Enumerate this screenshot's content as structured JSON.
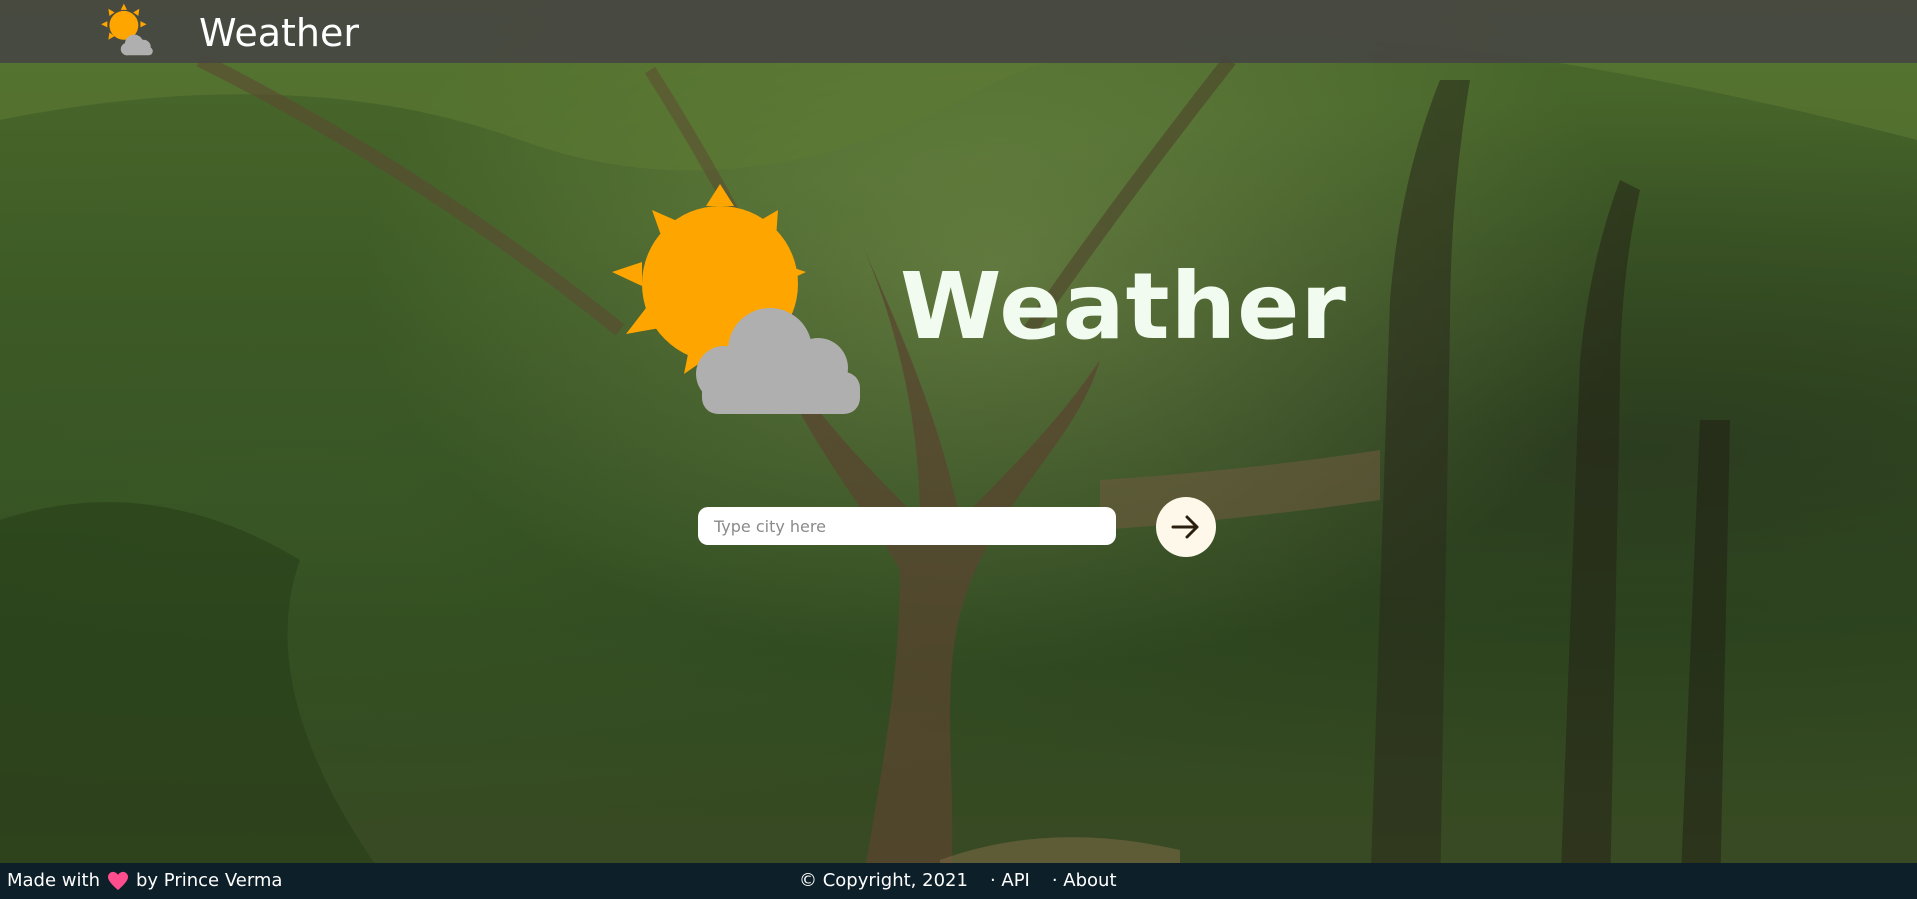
{
  "header": {
    "brand": "Weather",
    "logo_icon": "sun-cloud-icon"
  },
  "hero": {
    "title": "Weather",
    "logo_icon": "sun-cloud-icon"
  },
  "search": {
    "placeholder": "Type city here",
    "value": "",
    "submit_icon": "arrow-right-icon"
  },
  "footer": {
    "made_with": "Made with",
    "by": "by Prince Verma",
    "heart_icon": "heart-icon",
    "copyright": "© Copyright, 2021",
    "links": [
      "· API",
      "· About"
    ]
  },
  "colors": {
    "sun": "#FFA500",
    "cloud": "#AFAFAF",
    "topbar": "#464642",
    "footer": "#0D1F28",
    "heart": "#FF4D8D",
    "button": "#FDF8EA"
  }
}
